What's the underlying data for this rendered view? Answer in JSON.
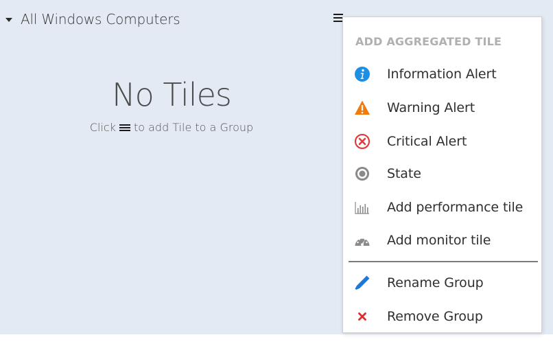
{
  "group": {
    "title": "All Windows Computers"
  },
  "empty_state": {
    "title": "No Tiles",
    "hint_before": "Click",
    "hint_after": "to add Tile to a Group"
  },
  "menu": {
    "heading": "ADD AGGREGATED TILE",
    "items": [
      {
        "label": "Information Alert",
        "icon": "info-icon"
      },
      {
        "label": "Warning Alert",
        "icon": "warning-icon"
      },
      {
        "label": "Critical Alert",
        "icon": "critical-icon"
      },
      {
        "label": "State",
        "icon": "state-icon"
      },
      {
        "label": "Add performance tile",
        "icon": "performance-chart-icon"
      },
      {
        "label": "Add monitor tile",
        "icon": "monitor-gauge-icon"
      }
    ],
    "group_actions": [
      {
        "label": "Rename Group",
        "icon": "pencil-icon"
      },
      {
        "label": "Remove Group",
        "icon": "close-x-icon"
      }
    ]
  },
  "colors": {
    "background": "#e3eaf4",
    "info": "#1e90e4",
    "warning": "#f07a0c",
    "critical": "#e03c3c",
    "state": "#8a8a8a",
    "pencil": "#1e78d6",
    "remove": "#d9302c"
  }
}
